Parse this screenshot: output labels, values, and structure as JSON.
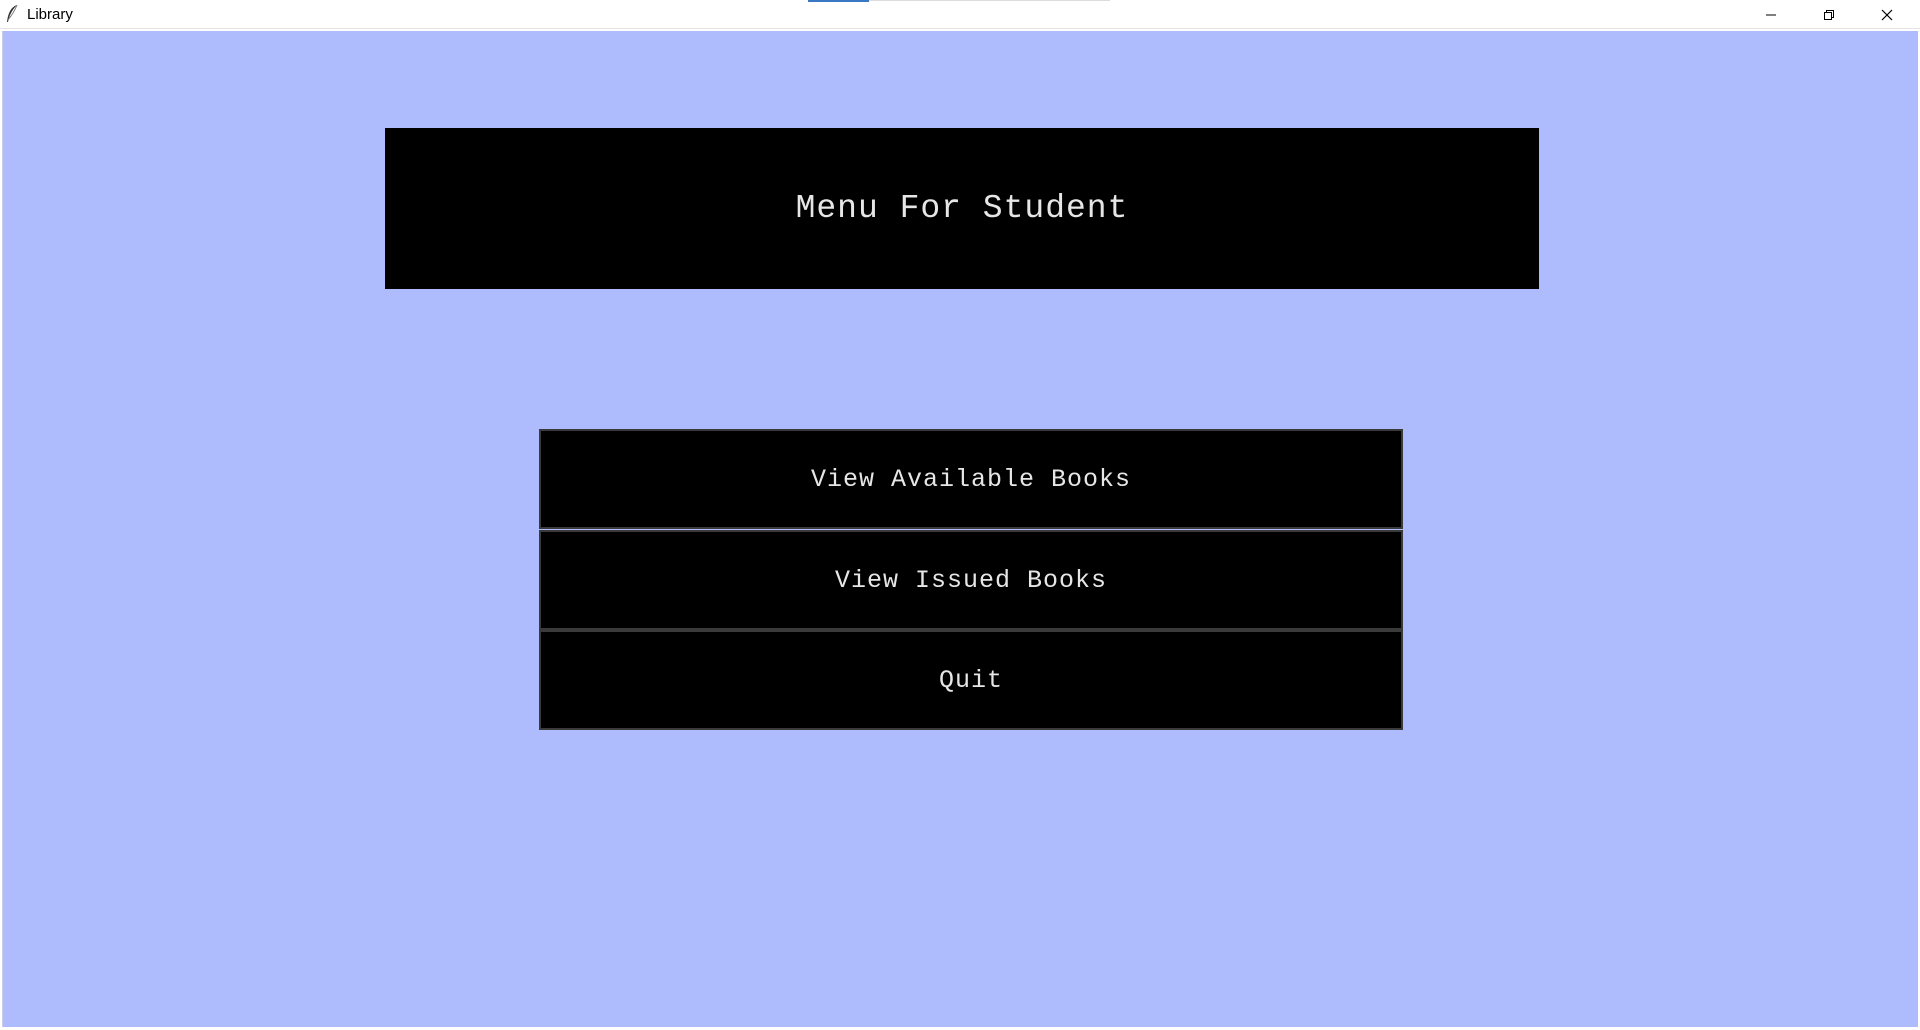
{
  "window": {
    "title": "Library",
    "icon": "feather-icon",
    "controls": {
      "minimize_icon": "minimize-icon",
      "maximize_icon": "restore-icon",
      "close_icon": "close-icon"
    }
  },
  "menu": {
    "heading": "Menu For Student",
    "buttons": [
      {
        "label": "View Available Books"
      },
      {
        "label": "View Issued Books"
      },
      {
        "label": "Quit"
      }
    ]
  },
  "colors": {
    "background": "#aebbfd",
    "panel": "#000000",
    "text": "#e6e6e6"
  }
}
